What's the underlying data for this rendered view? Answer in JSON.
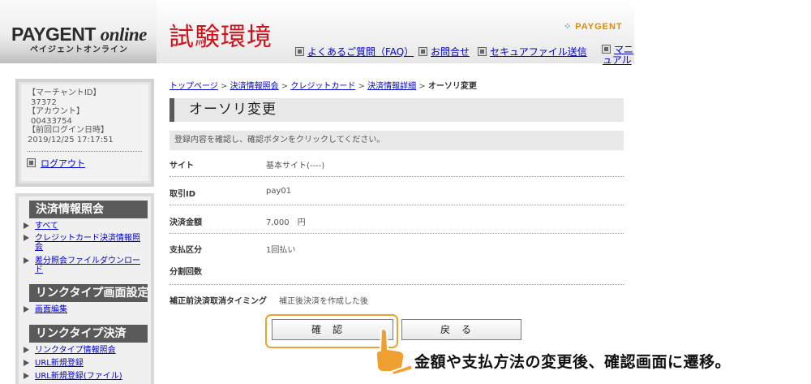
{
  "header": {
    "logo_main": "PAYGENT",
    "logo_online": "online",
    "logo_sub": "ペイジェントオンライン",
    "test_env": "試験環境",
    "brand": "PAYGENT",
    "links": [
      {
        "label": "よくあるご質問（FAQ）"
      },
      {
        "label": "お問合せ"
      },
      {
        "label": "セキュアファイル送信"
      }
    ],
    "manual_label": "マニュアル"
  },
  "merchant": {
    "merchant_id_label": "【マーチャントID】",
    "merchant_id": "37372",
    "account_label": "【アカウント】",
    "account": "00433754",
    "last_login_label": "【前回ログイン日時】",
    "last_login": "2019/12/25 17:17:51",
    "logout_label": "ログアウト"
  },
  "sidebar": {
    "sections": [
      {
        "heading": "決済情報照会",
        "items": [
          "すべて",
          "クレジットカード決済情報照会",
          "差分照会ファイルダウンロード"
        ]
      },
      {
        "heading": "リンクタイプ画面設定",
        "items": [
          "画面編集"
        ]
      },
      {
        "heading": "リンクタイプ決済",
        "items": [
          "リンクタイプ情報照会",
          "URL新規登録",
          "URL新規登録(ファイル)"
        ]
      }
    ]
  },
  "breadcrumb": {
    "items": [
      "トップページ",
      "決済情報照会",
      "クレジットカード",
      "決済情報詳細"
    ],
    "separator": ">",
    "current": "オーソリ変更"
  },
  "page": {
    "title": "オーソリ変更",
    "notice": "登録内容を確認し、確認ボタンをクリックしてください。"
  },
  "details": {
    "site_label": "サイト",
    "site_value": "基本サイト(----)",
    "trading_id_label": "取引ID",
    "trading_id_value": "pay01",
    "amount_label": "決済金額",
    "amount_value": "7,000　円",
    "payment_class_label": "支払区分",
    "payment_class_value": "1回払い",
    "split_count_label": "分割回数",
    "split_count_value": "",
    "cancel_timing_label": "補正前決済取消タイミング",
    "cancel_timing_value": "補正後決済を作成した後"
  },
  "buttons": {
    "confirm": "確認",
    "back": "戻る"
  },
  "annotation": {
    "text": "金額や支払方法の変更後、確認画面に遷移。",
    "color": "#f0a030"
  }
}
